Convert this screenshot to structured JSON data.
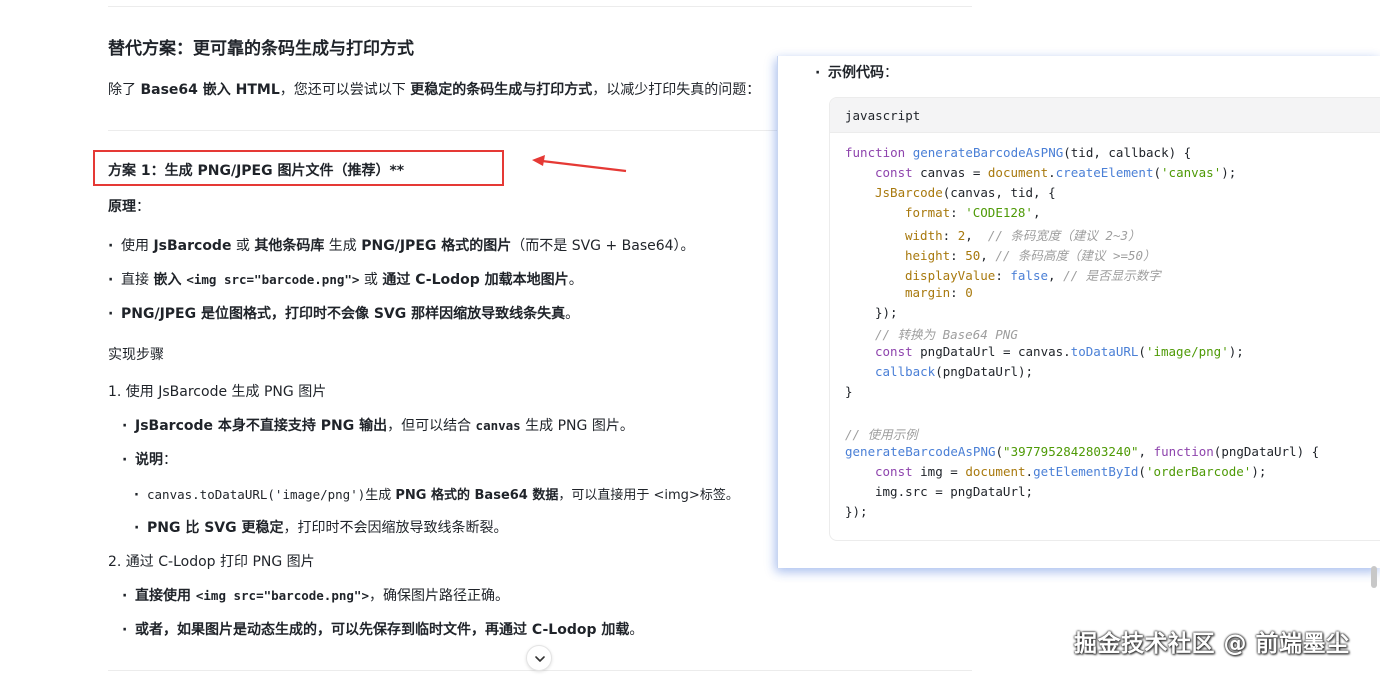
{
  "article": {
    "heading": "替代方案：更可靠的条码生成与打印方式",
    "intro_prefix": "除了 ",
    "intro_bold1": "Base64 嵌入 HTML",
    "intro_mid": "，您还可以尝试以下 ",
    "intro_bold2": "更稳定的条码生成与打印方式",
    "intro_suffix": "，以减少打印失真的问题："
  },
  "option1": {
    "title": "方案 1：生成 PNG/JPEG 图片文件（推荐）**",
    "principle_label": "原理",
    "principle_colon": "：",
    "bullets": [
      {
        "pre": "使用 ",
        "b1": "JsBarcode",
        "mid1": " 或 ",
        "b2": "其他条码库",
        "mid2": " 生成 ",
        "b3": "PNG/JPEG 格式的图片",
        "post": "（而不是 SVG + Base64）。"
      },
      {
        "pre": "直接 ",
        "b1": "嵌入 ",
        "code": "<img src=\"barcode.png\">",
        "mid1": " 或 ",
        "b2": "通过 C-Lodop 加载本地图片",
        "post": "。"
      },
      {
        "b1": "PNG/JPEG 是位图格式，打印时不会像 SVG 那样因缩放导致线条失真",
        "post": "。"
      }
    ],
    "steps_label": "实现步骤",
    "step1": {
      "title": "1. 使用 JsBarcode 生成 PNG 图片",
      "item1_b": "JsBarcode 本身不直接支持 PNG 输出",
      "item1_mid": "，但可以结合 ",
      "item1_code": "canvas",
      "item1_post": " 生成 PNG 图片。",
      "item2_b": "说明",
      "item2_colon": "：",
      "sub1_code": "canvas.toDataURL('image/png')",
      "sub1_mid": "生成 ",
      "sub1_b": "PNG 格式的 Base64 数据",
      "sub1_post": "，可以直接用于 <img>标签。",
      "sub2_b": "PNG 比 SVG 更稳定",
      "sub2_post": "，打印时不会因缩放导致线条断裂。"
    },
    "step2": {
      "title": "2. 通过 C-Lodop 打印 PNG 图片",
      "item1_b1": "直接使用 ",
      "item1_code": "<img src=\"barcode.png\">",
      "item1_post": "，确保图片路径正确。",
      "item2_b": "或者，如果图片是动态生成的，可以先保存到临时文件，再通过 C-Lodop 加载",
      "item2_post": "。"
    }
  },
  "code_panel": {
    "title": "示例代码",
    "title_colon": "：",
    "language": "javascript"
  },
  "code": {
    "l1_kw": "function ",
    "l1_fn": "generateBarcodeAsPNG",
    "l1_rest": "(tid, callback) {",
    "l2_kw": "const ",
    "l2_a": "canvas = ",
    "l2_obj": "document",
    "l2_dot": ".",
    "l2_fn": "createElement",
    "l2_op": "(",
    "l2_str": "'canvas'",
    "l2_end": ");",
    "l3_fn": "JsBarcode",
    "l3_rest": "(canvas, tid, {",
    "l4_prop": "format",
    "l4_sep": ": ",
    "l4_str": "'CODE128'",
    "l4_end": ",",
    "l5_prop": "width",
    "l5_sep": ": ",
    "l5_num": "2",
    "l5_end": ",  ",
    "l5_cm": "// 条码宽度（建议 2~3）",
    "l6_prop": "height",
    "l6_sep": ": ",
    "l6_num": "50",
    "l6_end": ", ",
    "l6_cm": "// 条码高度（建议 >=50）",
    "l7_prop": "displayValue",
    "l7_sep": ": ",
    "l7_num": "false",
    "l7_end": ", ",
    "l7_cm": "// 是否显示数字",
    "l8_prop": "margin",
    "l8_sep": ": ",
    "l8_num": "0",
    "l9": "});",
    "l10_cm": "// 转换为 Base64 PNG",
    "l11_kw": "const ",
    "l11_a": "pngDataUrl = canvas.",
    "l11_fn": "toDataURL",
    "l11_op": "(",
    "l11_str": "'image/png'",
    "l11_end": ");",
    "l12_fn": "callback",
    "l12_rest": "(pngDataUrl);",
    "l13": "}",
    "l14_cm": "// 使用示例",
    "l15_fn": "generateBarcodeAsPNG",
    "l15_op": "(",
    "l15_str": "\"3977952842803240\"",
    "l15_mid": ", ",
    "l15_kw": "function",
    "l15_rest": "(pngDataUrl) {",
    "l16_kw": "const ",
    "l16_a": "img = ",
    "l16_obj": "document",
    "l16_dot": ".",
    "l16_fn": "getElementById",
    "l16_op": "(",
    "l16_str": "'orderBarcode'",
    "l16_end": ");",
    "l17": "img.src = pngDataUrl;",
    "l18": "});"
  },
  "watermark": "掘金技术社区 @ 前端墨尘",
  "colors": {
    "highlight": "#e53935",
    "keyword": "#8e44ad",
    "function": "#4a7fd6",
    "string": "#4e9a06",
    "property": "#a8790e",
    "comment": "#9e9e9e"
  },
  "icons": {
    "arrow": "red-arrow-icon",
    "scroll": "chevron-down-icon"
  }
}
